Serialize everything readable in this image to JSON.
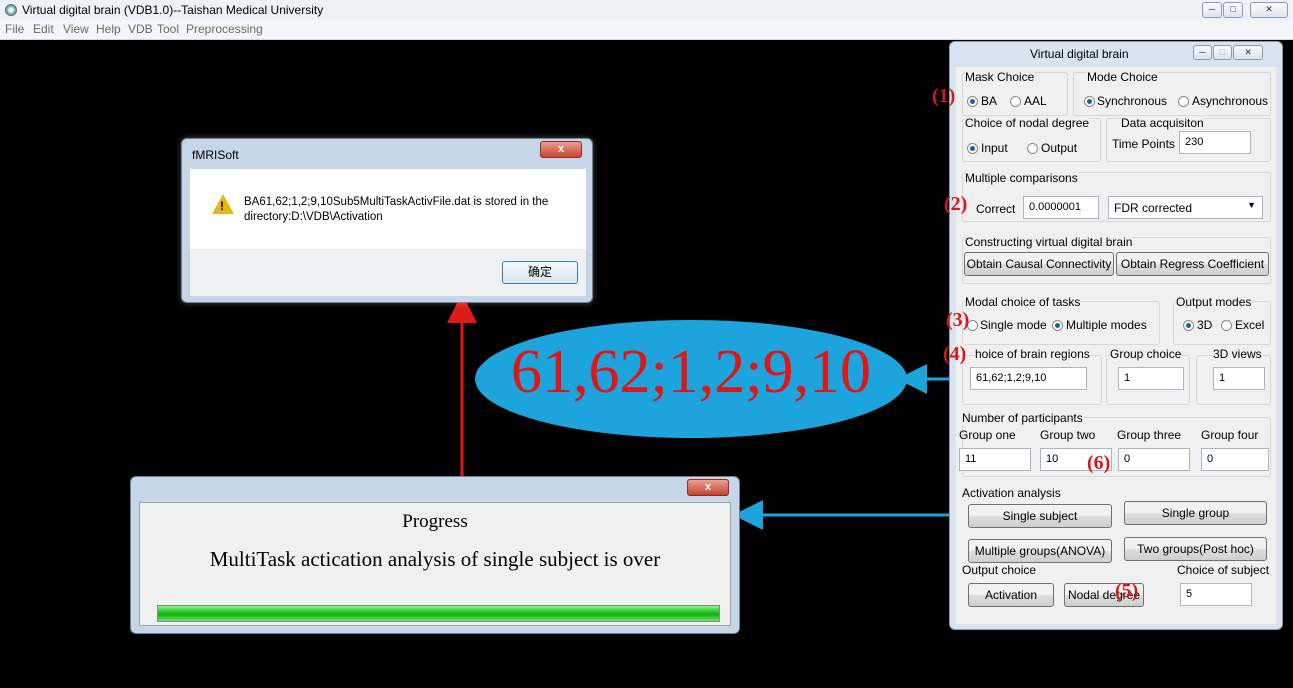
{
  "window": {
    "title": "Virtual digital brain (VDB1.0)--Taishan Medical University",
    "menu": [
      "File",
      "Edit",
      "View",
      "Help",
      "VDB",
      "Tool",
      "Preprocessing"
    ]
  },
  "dialog": {
    "title": "fMRISoft",
    "close": "x",
    "message": "BA61,62;1,2;9,10Sub5MultiTaskActivFile.dat is stored in the directory:D:\\VDB\\Activation",
    "ok": "确定"
  },
  "ellipse": {
    "text": "61,62;1,2;9,10"
  },
  "progress": {
    "close": "x",
    "title": "Progress",
    "message": "MultiTask actication analysis of single subject is over",
    "value": 1.0
  },
  "panel": {
    "title": "Virtual  digital  brain",
    "mask_choice": {
      "label": "Mask Choice",
      "options": [
        "BA",
        "AAL"
      ],
      "selected": "BA"
    },
    "mode_choice": {
      "label": "Mode Choice",
      "options": [
        "Synchronous",
        "Asynchronous"
      ],
      "selected": "Synchronous"
    },
    "nodal_degree": {
      "label": "Choice of nodal degree",
      "options": [
        "Input",
        "Output"
      ],
      "selected": "Input"
    },
    "data_acq": {
      "label": "Data acquisiton",
      "field_label": "Time Points",
      "value": "230"
    },
    "multiple_comparisons": {
      "label": "Multiple comparisons",
      "field_label": "Correct",
      "value": "0.0000001",
      "method": "FDR corrected"
    },
    "constructing": {
      "label": "Constructing virtual digital brain",
      "btn_causal": "Obtain  Causal Connectivity",
      "btn_regress": "Obtain Regress Coefficient"
    },
    "modal_tasks": {
      "label": "Modal choice of tasks",
      "options": [
        "Single mode",
        "Multiple modes"
      ],
      "selected": "Multiple modes"
    },
    "output_modes": {
      "label": "Output modes",
      "options": [
        "3D",
        "Excel"
      ],
      "selected": "3D"
    },
    "regions": {
      "label": "hoice of brain regions",
      "value": "61,62;1,2;9,10"
    },
    "group_choice": {
      "label": "Group choice",
      "value": "1"
    },
    "views_3d": {
      "label": "3D views",
      "value": "1"
    },
    "participants": {
      "label": "Number of participants",
      "groups": [
        {
          "label": "Group one",
          "value": "11"
        },
        {
          "label": "Group two",
          "value": "10"
        },
        {
          "label": "Group three",
          "value": "0"
        },
        {
          "label": "Group four",
          "value": "0"
        }
      ]
    },
    "activation": {
      "label": "Activation analysis",
      "btn_single_subject": "Single subject",
      "btn_single_group": "Single group",
      "btn_anova": "Multiple groups(ANOVA)",
      "btn_posthoc": "Two groups(Post hoc)"
    },
    "output_choice": {
      "label": "Output choice",
      "btn_activation": "Activation",
      "btn_nodal": "Nodal degree"
    },
    "subject_choice": {
      "label": "Choice of subject",
      "value": "5"
    }
  },
  "annotations": [
    "(1)",
    "(2)",
    "(3)",
    "(4)",
    "(5)",
    "(6)"
  ],
  "colors": {
    "arrow_red": "#e01a1a",
    "arrow_blue": "#1da4dc",
    "ellipse": "#1da4dc"
  }
}
